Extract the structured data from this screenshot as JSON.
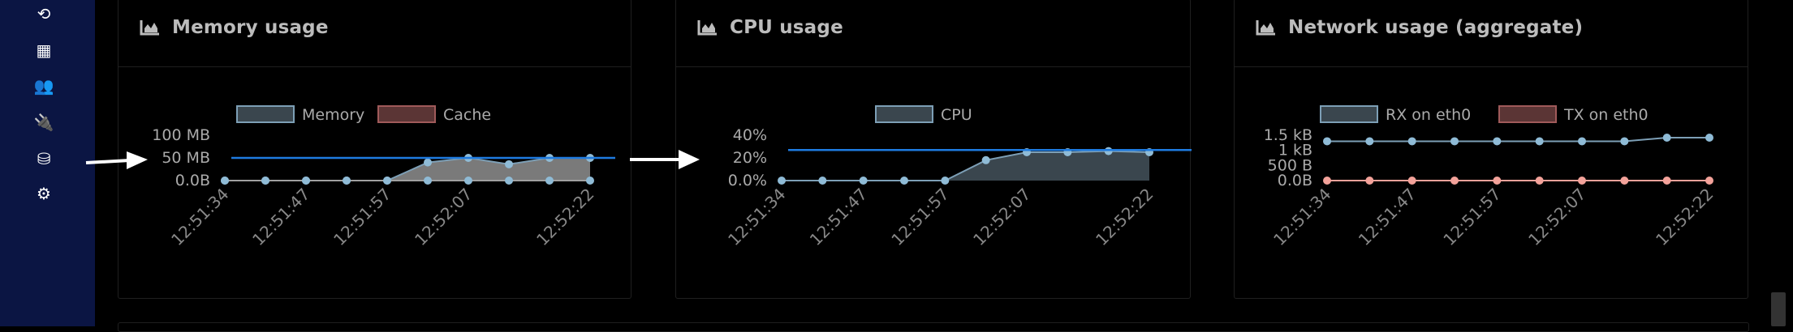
{
  "sidebar": {
    "items": [
      {
        "icon": "history-icon",
        "glyph": "⟲"
      },
      {
        "icon": "grid-icon",
        "glyph": "▦"
      },
      {
        "icon": "users-icon",
        "glyph": "👥"
      },
      {
        "icon": "plug-icon",
        "glyph": "🔌"
      },
      {
        "icon": "database-icon",
        "glyph": "⛁"
      },
      {
        "icon": "cogs-icon",
        "glyph": "⚙"
      }
    ]
  },
  "colors": {
    "sidebar_bg": "#0b1543",
    "threshold_line": "#1e7be0",
    "series_point": "#8fbbd6",
    "series_line": "#7d9fb6",
    "memory_fill": "#7a7a7a",
    "cpu_fill": "#3a464e",
    "cache_legend": "#a05a5a",
    "tx_point": "#f3a29a"
  },
  "panels": [
    {
      "title": "Memory usage",
      "icon": "area-chart-icon",
      "chart_data": {
        "type": "area",
        "x": [
          "12:51:34",
          "12:51:39",
          "12:51:44",
          "12:51:49",
          "12:51:54",
          "12:51:59",
          "12:52:04",
          "12:52:09",
          "12:52:14",
          "12:52:19"
        ],
        "tick_labels": [
          "12:51:34",
          "12:51:47",
          "12:51:57",
          "12:52:07",
          "12:52:22"
        ],
        "y_ticks": [
          "100 MB",
          "50 MB",
          "0.0B"
        ],
        "ylim": [
          0,
          100
        ],
        "threshold": 50,
        "series": [
          {
            "name": "Memory",
            "values": [
              0,
              0,
              0,
              0,
              0,
              40,
              50,
              36,
              50,
              50
            ]
          },
          {
            "name": "Cache",
            "values": [
              0,
              0,
              0,
              0,
              0,
              0,
              0,
              0,
              0,
              0
            ]
          }
        ]
      }
    },
    {
      "title": "CPU usage",
      "icon": "area-chart-icon",
      "chart_data": {
        "type": "area",
        "x": [
          "12:51:34",
          "12:51:39",
          "12:51:44",
          "12:51:49",
          "12:51:54",
          "12:51:59",
          "12:52:04",
          "12:52:09",
          "12:52:14",
          "12:52:19"
        ],
        "tick_labels": [
          "12:51:34",
          "12:51:47",
          "12:51:57",
          "12:52:07",
          "12:52:22"
        ],
        "y_ticks": [
          "40%",
          "20%",
          "0.0%"
        ],
        "ylim": [
          0,
          40
        ],
        "threshold": 27,
        "series": [
          {
            "name": "CPU",
            "values": [
              0,
              0,
              0,
              0,
              0,
              18,
              25,
              25,
              26,
              25
            ]
          }
        ]
      }
    },
    {
      "title": "Network usage (aggregate)",
      "icon": "area-chart-icon",
      "chart_data": {
        "type": "line",
        "x": [
          "12:51:34",
          "12:51:38",
          "12:51:42",
          "12:51:46",
          "12:51:50",
          "12:51:54",
          "12:51:58",
          "12:52:02",
          "12:52:06",
          "12:52:10"
        ],
        "tick_labels": [
          "12:51:34",
          "12:51:47",
          "12:51:57",
          "12:52:07",
          "12:52:22"
        ],
        "y_ticks": [
          "1.5 kB",
          "1 kB",
          "500 B",
          "0.0B"
        ],
        "ylim": [
          0,
          1500
        ],
        "series": [
          {
            "name": "RX on eth0",
            "values": [
              1300,
              1300,
              1300,
              1300,
              1300,
              1300,
              1300,
              1300,
              1420,
              1420
            ]
          },
          {
            "name": "TX on eth0",
            "values": [
              0,
              0,
              0,
              0,
              0,
              0,
              0,
              0,
              0,
              0
            ]
          }
        ]
      }
    }
  ]
}
